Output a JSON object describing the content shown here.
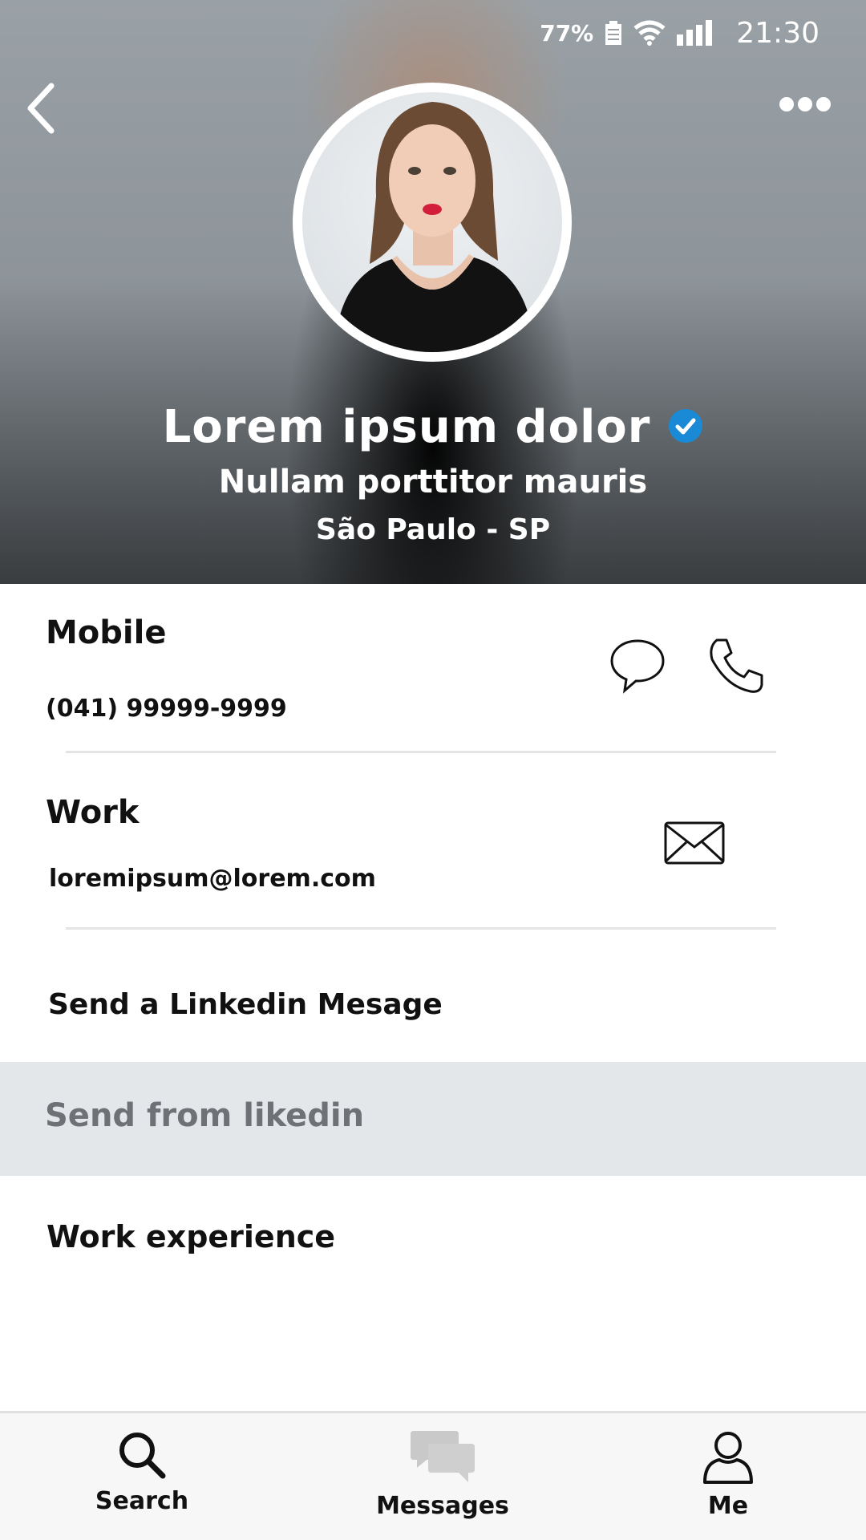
{
  "status_bar": {
    "battery": "77%",
    "time": "21:30"
  },
  "profile": {
    "name": "Lorem ipsum dolor",
    "headline": "Nullam porttitor mauris",
    "location": "São Paulo - SP"
  },
  "contact": {
    "mobile_title": "Mobile",
    "mobile_value": "(041) 99999-9999",
    "work_title": "Work",
    "work_value": "loremipsum@lorem.com"
  },
  "links": {
    "linkedin_message": "Send a Linkedin Mesage"
  },
  "band": {
    "label": "Send from likedin"
  },
  "sections": {
    "work_experience": "Work experience"
  },
  "bottom_nav": {
    "items": [
      {
        "label": "Search",
        "icon": "search-icon"
      },
      {
        "label": "Messages",
        "icon": "messages-icon"
      },
      {
        "label": "Me",
        "icon": "person-icon"
      }
    ]
  },
  "colors": {
    "verified": "#1a8ad6",
    "band": "#e4e7ea",
    "muted_text": "#6e7175"
  }
}
